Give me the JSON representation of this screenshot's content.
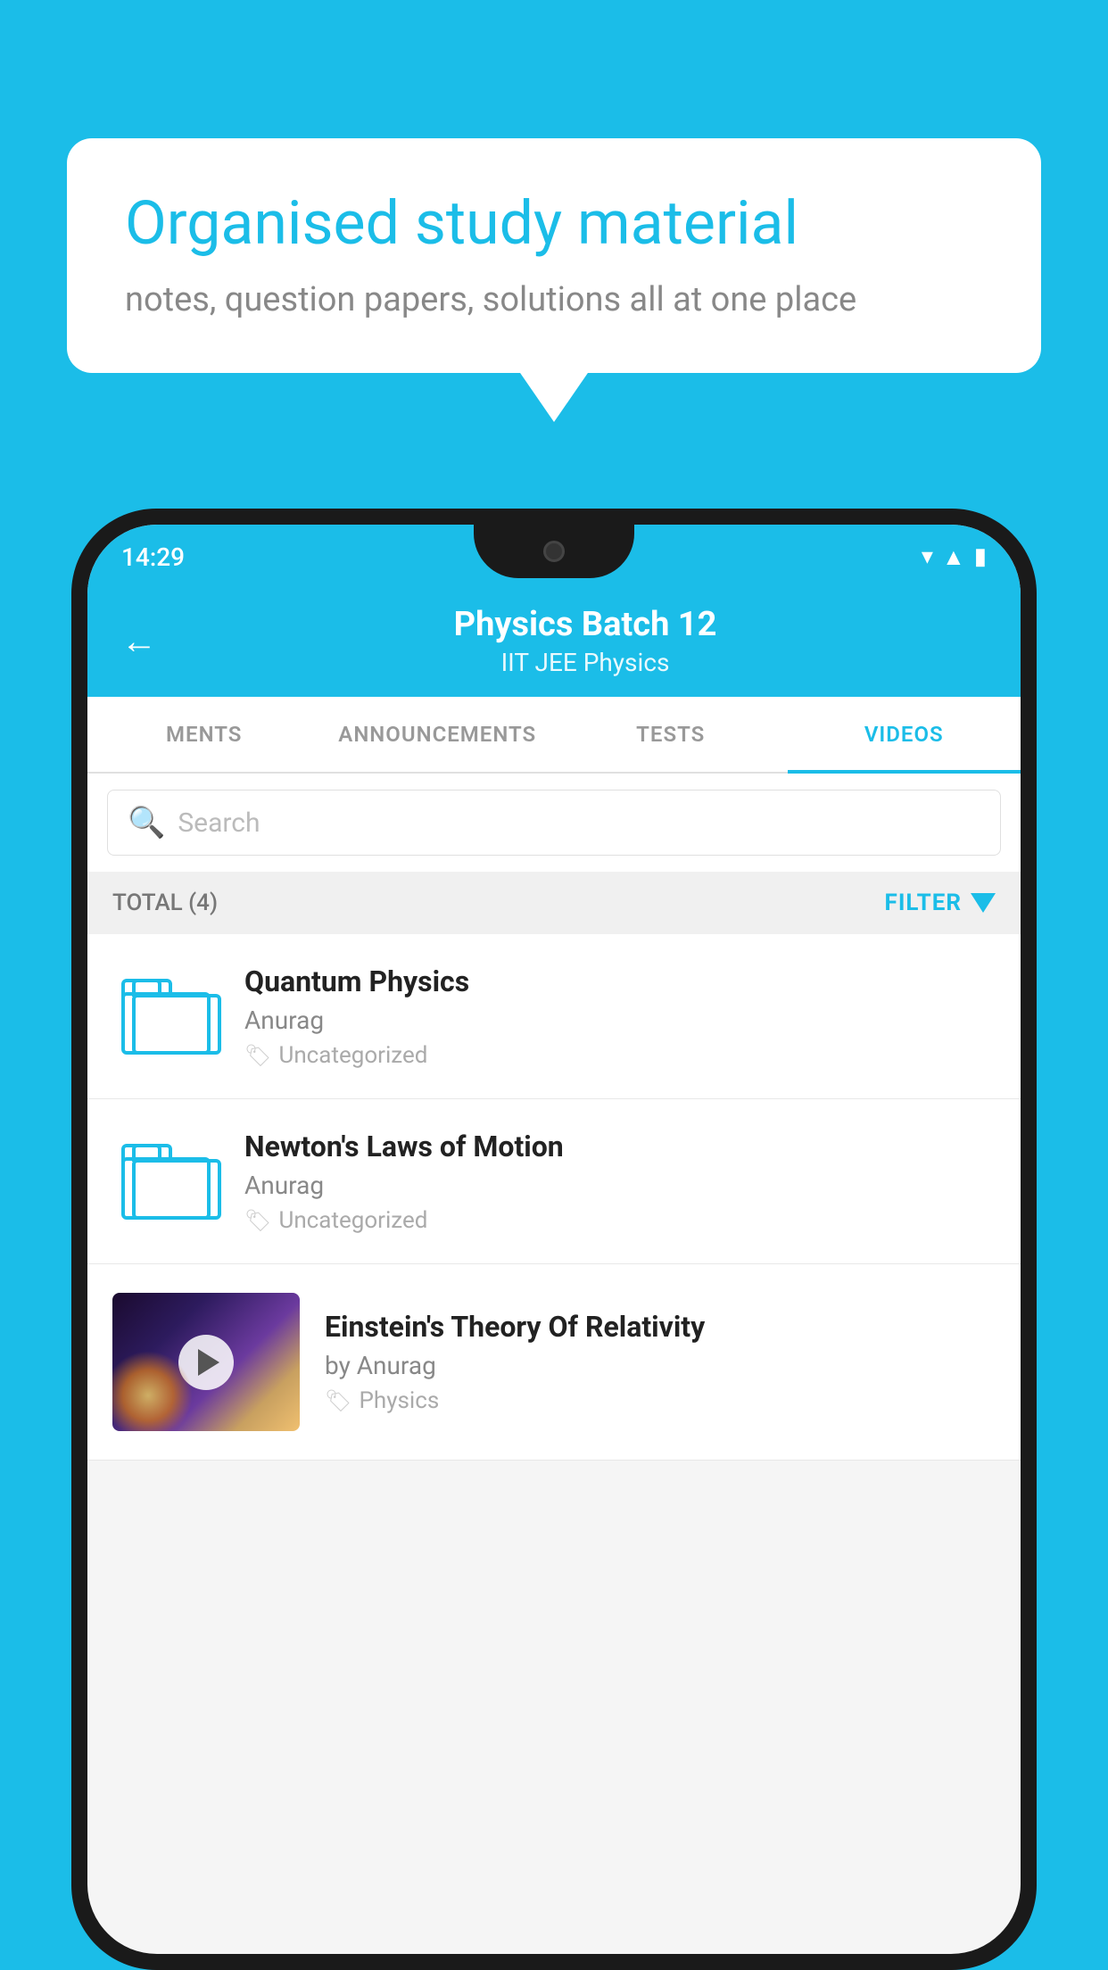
{
  "background_color": "#1BBDE8",
  "speech_bubble": {
    "title": "Organised study material",
    "subtitle": "notes, question papers, solutions all at one place"
  },
  "status_bar": {
    "time": "14:29",
    "wifi": "▾",
    "signal": "▲",
    "battery": "▮"
  },
  "app_header": {
    "back_label": "←",
    "title": "Physics Batch 12",
    "subtitle": "IIT JEE   Physics"
  },
  "tabs": [
    {
      "label": "MENTS",
      "active": false
    },
    {
      "label": "ANNOUNCEMENTS",
      "active": false
    },
    {
      "label": "TESTS",
      "active": false
    },
    {
      "label": "VIDEOS",
      "active": true
    }
  ],
  "search": {
    "placeholder": "Search"
  },
  "filter_bar": {
    "total_label": "TOTAL (4)",
    "filter_label": "FILTER"
  },
  "video_items": [
    {
      "id": 1,
      "title": "Quantum Physics",
      "author": "Anurag",
      "tag": "Uncategorized",
      "type": "folder"
    },
    {
      "id": 2,
      "title": "Newton's Laws of Motion",
      "author": "Anurag",
      "tag": "Uncategorized",
      "type": "folder"
    },
    {
      "id": 3,
      "title": "Einstein's Theory Of Relativity",
      "author": "by Anurag",
      "tag": "Physics",
      "type": "video"
    }
  ]
}
